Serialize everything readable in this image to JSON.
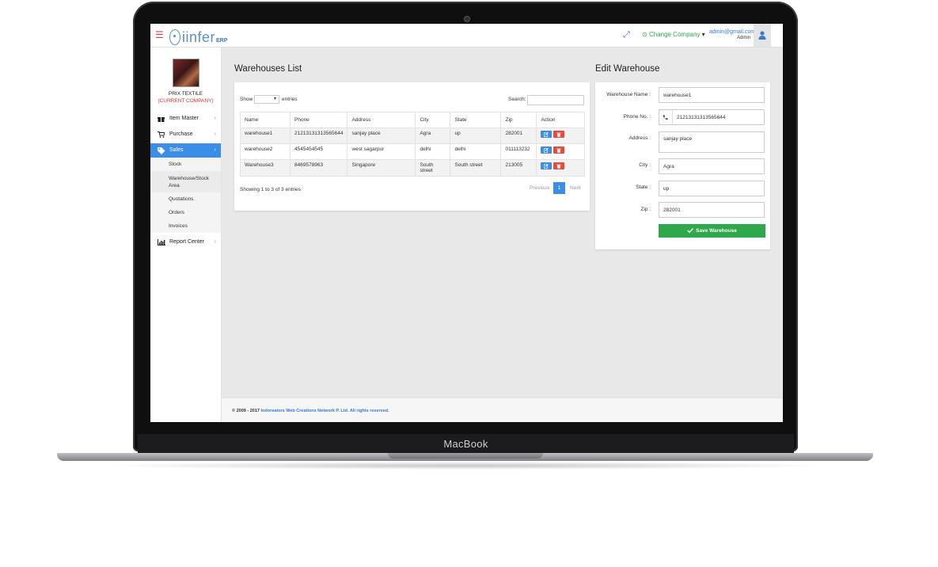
{
  "device": {
    "brand": "MacBook"
  },
  "header": {
    "logo_text": "iinfer",
    "logo_sub": "ERP",
    "change_company": "Change Company",
    "user_email": "admin@gmail.com",
    "user_role": "Admin"
  },
  "sidebar": {
    "company_name": "PRIX TEXTILE",
    "current_label": "(CURRENT COMPANY)",
    "items": [
      {
        "label": "Item Master",
        "icon": "gift-icon"
      },
      {
        "label": "Purchase",
        "icon": "cart-icon"
      },
      {
        "label": "Sales",
        "icon": "tag-icon"
      },
      {
        "label": "Report Center",
        "icon": "bar-chart-icon"
      }
    ],
    "sub_items": [
      "Stock",
      "Warehouse/Stock Area",
      "Quotations",
      "Orders",
      "Invoices"
    ]
  },
  "list": {
    "title": "Warehouses List",
    "show_label": "Show",
    "entries_label": "entries",
    "search_label": "Search:",
    "columns": [
      "Name",
      "Phone",
      "Address",
      "City",
      "State",
      "Zip",
      "Action"
    ],
    "rows": [
      {
        "name": "warehouse1",
        "phone": "21213131313565644",
        "address": "sanjay place",
        "city": "Agra",
        "state": "up",
        "zip": "282001"
      },
      {
        "name": "warehouse2",
        "phone": "4545454545",
        "address": "west sagarpur",
        "city": "delhi",
        "state": "delhi",
        "zip": "011113232"
      },
      {
        "name": "Warehouse3",
        "phone": "8469578963",
        "address": "Singapore",
        "city": "South street",
        "state": "South street",
        "zip": "213005"
      }
    ],
    "info": "Showing 1 to 3 of 3 entries",
    "pagination": {
      "previous": "Previous",
      "current": "1",
      "next": "Next"
    }
  },
  "form": {
    "title": "Edit Warehouse",
    "fields": [
      {
        "label": "Warehouse Name :",
        "value": "warehouse1"
      },
      {
        "label": "Phone No. :",
        "value": "21213131313565644"
      },
      {
        "label": "Address :",
        "value": "sanjay place"
      },
      {
        "label": "City :",
        "value": "Agra"
      },
      {
        "label": "State :",
        "value": "up"
      },
      {
        "label": "Zip :",
        "value": "282001"
      }
    ],
    "save_label": "Save Warehouse"
  },
  "footer": {
    "copyright": "© 2009 - 2017 ",
    "company": "Indoreators Web Creations Network P. Ltd.",
    "rights": " All rights reserved."
  },
  "colors": {
    "primary": "#3b8ee8",
    "success": "#2ea84a",
    "danger": "#e84a3b",
    "accent_red": "#e03030"
  }
}
